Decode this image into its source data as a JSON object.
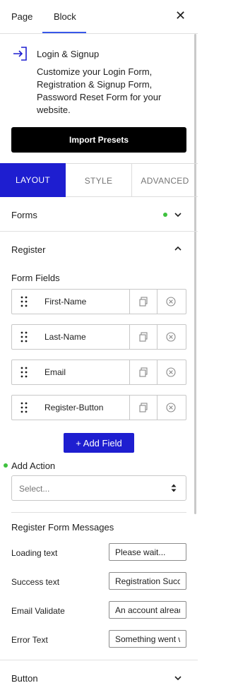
{
  "tabs": {
    "page": "Page",
    "block": "Block"
  },
  "block_card": {
    "title": "Login & Signup",
    "description": "Customize your Login Form, Registration & Signup Form, Password Reset Form for your website."
  },
  "import_presets": "Import Presets",
  "settings_tabs": {
    "layout": "LAYOUT",
    "style": "STYLE",
    "advanced": "ADVANCED"
  },
  "forms_section": {
    "label": "Forms"
  },
  "register_section": {
    "label": "Register",
    "form_fields_label": "Form Fields",
    "fields": [
      "First-Name",
      "Last-Name",
      "Email",
      "Register-Button"
    ],
    "add_field": "+ Add Field",
    "add_action_label": "Add Action",
    "add_action_placeholder": "Select..."
  },
  "messages": {
    "title": "Register Form Messages",
    "rows": [
      {
        "label": "Loading text",
        "value": "Please wait..."
      },
      {
        "label": "Success text",
        "value": "Registration Successful"
      },
      {
        "label": "Email Validate",
        "value": "An account already exists"
      },
      {
        "label": "Error Text",
        "value": "Something went wrong"
      }
    ]
  },
  "button_section": {
    "label": "Button"
  },
  "colors": {
    "accent": "#1e1ed0",
    "indicator": "#3ec13e",
    "tab_underline": "#3858e9"
  }
}
